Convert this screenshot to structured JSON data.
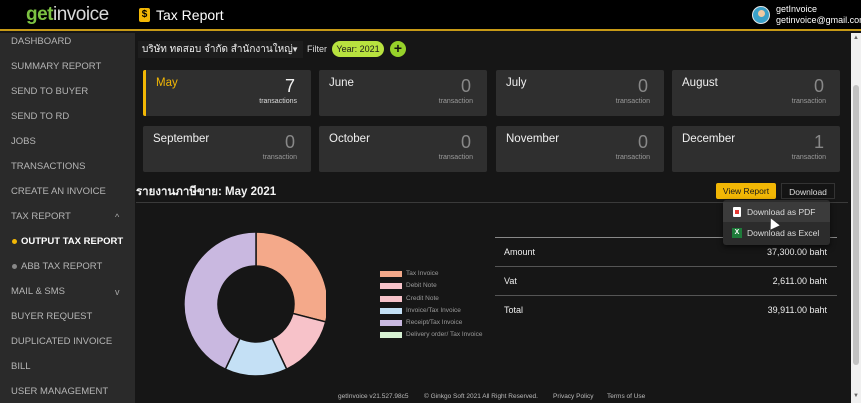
{
  "app": {
    "logo_get": "get",
    "logo_invoice": "invoice",
    "page_icon": "$",
    "page_title": "Tax Report",
    "user_name": "getInvoice",
    "user_email": "getinvoice@gmail.com"
  },
  "sidebar": {
    "items": [
      {
        "label": "DASHBOARD"
      },
      {
        "label": "SUMMARY REPORT"
      },
      {
        "label": "SEND TO BUYER"
      },
      {
        "label": "SEND TO RD"
      },
      {
        "label": "JOBS"
      },
      {
        "label": "TRANSACTIONS"
      },
      {
        "label": "CREATE AN INVOICE"
      },
      {
        "label": "TAX REPORT",
        "chevron": "^"
      },
      {
        "label": "OUTPUT TAX REPORT"
      },
      {
        "label": "ABB TAX REPORT"
      },
      {
        "label": "MAIL & SMS",
        "chevron": "v"
      },
      {
        "label": "BUYER REQUEST"
      },
      {
        "label": "DUPLICATED INVOICE"
      },
      {
        "label": "BILL"
      },
      {
        "label": "USER MANAGEMENT"
      }
    ]
  },
  "toolbar": {
    "company": "บริษัท ทดสอบ จำกัด สำนักงานใหญ่",
    "filter_label": "Filter",
    "year_pill": "Year: 2021",
    "add": "+"
  },
  "months": [
    {
      "name": "May",
      "count": "7",
      "unit": "transactions",
      "selected": true
    },
    {
      "name": "June",
      "count": "0",
      "unit": "transaction"
    },
    {
      "name": "July",
      "count": "0",
      "unit": "transaction"
    },
    {
      "name": "August",
      "count": "0",
      "unit": "transaction"
    },
    {
      "name": "September",
      "count": "0",
      "unit": "transaction"
    },
    {
      "name": "October",
      "count": "0",
      "unit": "transaction"
    },
    {
      "name": "November",
      "count": "0",
      "unit": "transaction"
    },
    {
      "name": "December",
      "count": "1",
      "unit": "transaction"
    }
  ],
  "report": {
    "title": "รายงานภาษีขาย: May 2021",
    "view_button": "View Report",
    "download_button": "Download",
    "download_menu": {
      "pdf": "Download as PDF",
      "excel": "Download as Excel",
      "excel_icon": "X"
    }
  },
  "chart_data": {
    "type": "pie",
    "donut": true,
    "legend": [
      {
        "name": "Tax Invoice",
        "color": "#f4a98a"
      },
      {
        "name": "Debit Note",
        "color": "#f7c2c9"
      },
      {
        "name": "Credit Note",
        "color": "#f7c2c9"
      },
      {
        "name": "Invoice/Tax Invoice",
        "color": "#c4e0f5"
      },
      {
        "name": "Receipt/Tax Invoice",
        "color": "#c9b8e0"
      },
      {
        "name": "Delivery order/ Tax Invoice",
        "color": "#d6f0d2"
      }
    ],
    "slices": [
      {
        "name": "Tax Invoice",
        "value": 29,
        "color": "#f4a98a"
      },
      {
        "name": "Credit Note",
        "value": 14,
        "color": "#f7c2c9"
      },
      {
        "name": "Invoice/Tax Invoice",
        "value": 14,
        "color": "#c4e0f5"
      },
      {
        "name": "Receipt/Tax Invoice",
        "value": 43,
        "color": "#c9b8e0"
      }
    ]
  },
  "summary": [
    {
      "label": "Amount",
      "value": "37,300.00 baht"
    },
    {
      "label": "Vat",
      "value": "2,611.00 baht"
    },
    {
      "label": "Total",
      "value": "39,911.00 baht"
    }
  ],
  "footer": {
    "version": "getInvoice v21.527.98c5",
    "copyright": "© Ginkgo Soft 2021 All Right Reserved.",
    "privacy": "Privacy Policy",
    "terms": "Terms of Use"
  },
  "colors": {
    "accent": "#f2b705",
    "year_pill": "#b8e23f",
    "sidebar_bg": "#2a2a2a",
    "card_bg": "#2f2f2f"
  }
}
